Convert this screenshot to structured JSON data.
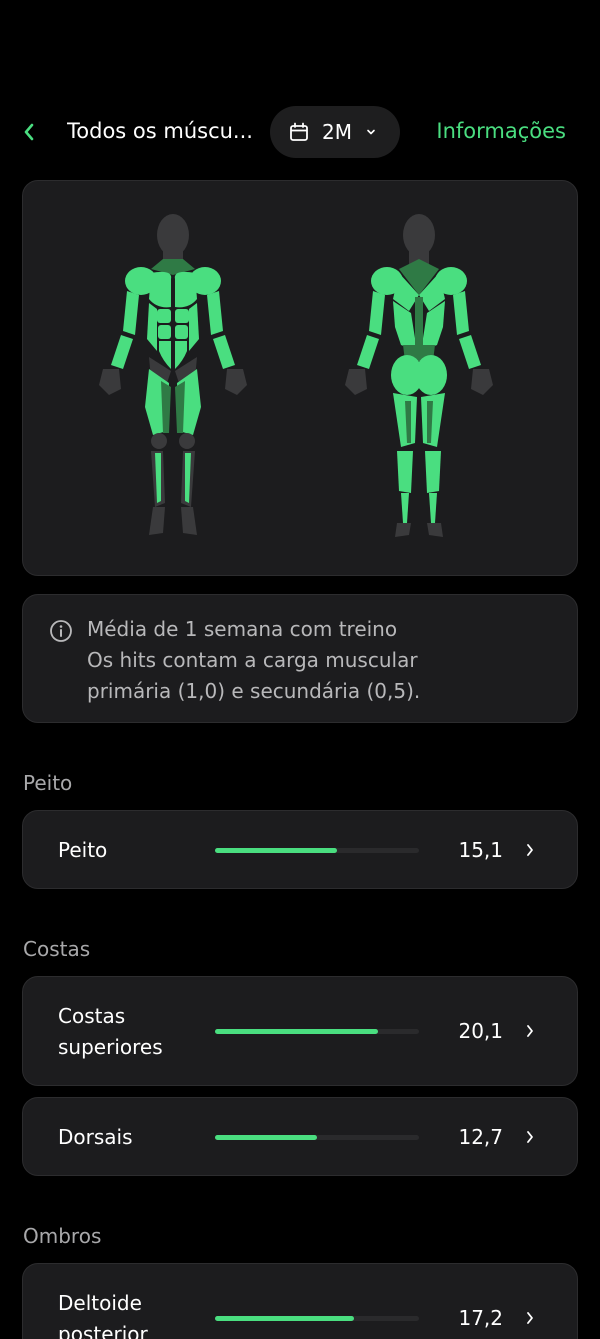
{
  "header": {
    "title": "Todos os múscu...",
    "period": "2M",
    "info_link": "Informações"
  },
  "note": {
    "line1": "Média de 1 semana com treino",
    "line2": "Os hits contam a carga muscular",
    "line3": "primária (1,0) e secundária (0,5)."
  },
  "sections": [
    {
      "title": "Peito",
      "rows": [
        {
          "label": "Peito",
          "value": "15,1",
          "fill": 0.6
        }
      ]
    },
    {
      "title": "Costas",
      "rows": [
        {
          "label": "Costas superiores",
          "value": "20,1",
          "fill": 0.8
        },
        {
          "label": "Dorsais",
          "value": "12,7",
          "fill": 0.5
        }
      ]
    },
    {
      "title": "Ombros",
      "rows": [
        {
          "label": "Deltoide posterior",
          "value": "17,2",
          "fill": 0.68
        }
      ]
    }
  ],
  "colors": {
    "accent": "#4ade80",
    "muscle_active": "#4ade80",
    "muscle_secondary": "#2f7a45",
    "muscle_inactive": "#3a3a3c",
    "card_bg": "#1c1c1e"
  }
}
